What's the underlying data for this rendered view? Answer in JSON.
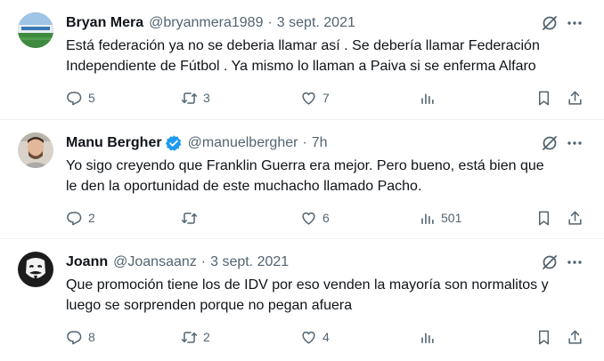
{
  "tweets": [
    {
      "name": "Bryan Mera",
      "handle": "@bryanmera1989",
      "sep": "·",
      "time": "3 sept. 2021",
      "verified": false,
      "text_lines": [
        "Está federación ya no se deberia llamar así . Se debería llamar Federación",
        "Independiente de Fútbol . Ya mismo lo llaman a Paiva si se enferma Alfaro"
      ],
      "replies": "5",
      "retweets": "3",
      "likes": "7",
      "views": ""
    },
    {
      "name": "Manu Bergher",
      "handle": "@manuelbergher",
      "sep": "·",
      "time": "7h",
      "verified": true,
      "text_lines": [
        "Yo sigo creyendo que Franklin Guerra era mejor. Pero bueno, está bien que",
        "le den la oportunidad de este muchacho llamado Pacho."
      ],
      "replies": "2",
      "retweets": "",
      "likes": "6",
      "views": "501"
    },
    {
      "name": "Joann",
      "handle": "@Joansaanz",
      "sep": "·",
      "time": "3 sept. 2021",
      "verified": false,
      "text_lines": [
        "Que promoción tiene los de IDV por eso venden la mayoría son normalitos y",
        "luego se sorprenden porque no pegan afuera"
      ],
      "replies": "8",
      "retweets": "2",
      "likes": "4",
      "views": ""
    }
  ],
  "icons": {
    "reply": "reply-icon",
    "retweet": "retweet-icon",
    "like": "heart-icon",
    "views": "views-icon",
    "bookmark": "bookmark-icon",
    "share": "share-icon",
    "grok": "grok-icon",
    "more": "more-icon",
    "verified": "verified-badge-icon"
  },
  "colors": {
    "text": "#0f1419",
    "secondary": "#536471",
    "verified": "#1d9bf0",
    "divider": "#eff3f4"
  }
}
